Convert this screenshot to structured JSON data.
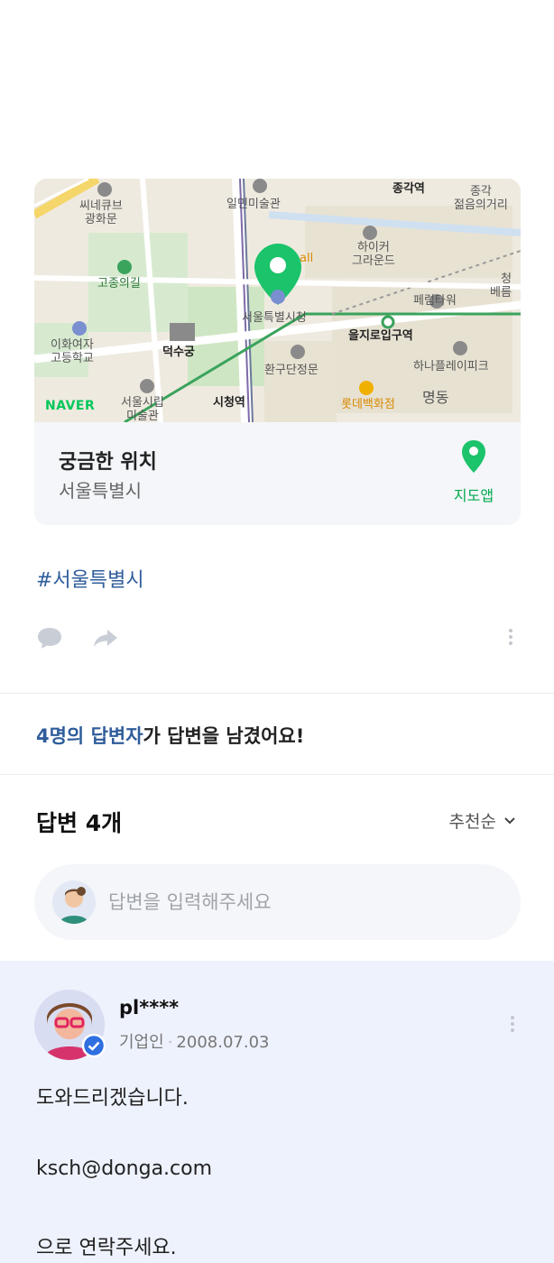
{
  "map": {
    "provider": "NAVER",
    "labels": {
      "cgv": "씨네큐브\n광화문",
      "ilmin": "일민미술관",
      "jonggak": "종각역",
      "jonggak_youth": "종각\n젊음의거리",
      "hiker": "하이커\n그라운드",
      "mall": "all",
      "gojong": "고종의길",
      "seoul_hall": "서울특별시청",
      "pedal_tower": "페럼타워",
      "cheong": "청\n베름",
      "ewha": "이화여자\n고등학교",
      "deoksu": "덕수궁",
      "euljiro": "을지로입구역",
      "hwangu": "환구단정문",
      "hana": "하나플레이피크",
      "lib": "서울시립\n미술관",
      "cityhall": "시청역",
      "lotte": "롯데백화점",
      "myeong": "명동"
    }
  },
  "place": {
    "name": "궁금한 위치",
    "address": "서울특별시",
    "map_app_label": "지도앱"
  },
  "hashtag": "#서울특별시",
  "icons": {
    "comment": "comment-icon",
    "share": "share-icon",
    "more": "more-vertical-icon",
    "pin": "map-pin-icon",
    "chevron": "chevron-down-icon",
    "verified": "verified-badge-icon"
  },
  "answer_summary": {
    "highlight": "4명의 답변자",
    "rest": "가 답변을 남겼어요!"
  },
  "answers": {
    "title": "답변 4개",
    "sort_label": "추천순",
    "input_placeholder": "답변을 입력해주세요"
  },
  "answer": {
    "user": "pl****",
    "role": "기업인",
    "date": "2008.07.03",
    "lines": [
      "도와드리겠습니다.",
      "ksch@donga.com",
      "으로 연락주세요."
    ]
  },
  "colors": {
    "accent_blue": "#2f5d9b",
    "naver_green": "#03c75a",
    "pin_green": "#1bc36a",
    "card_bg": "#f4f6f9",
    "answer_bg": "#eef2fd"
  }
}
